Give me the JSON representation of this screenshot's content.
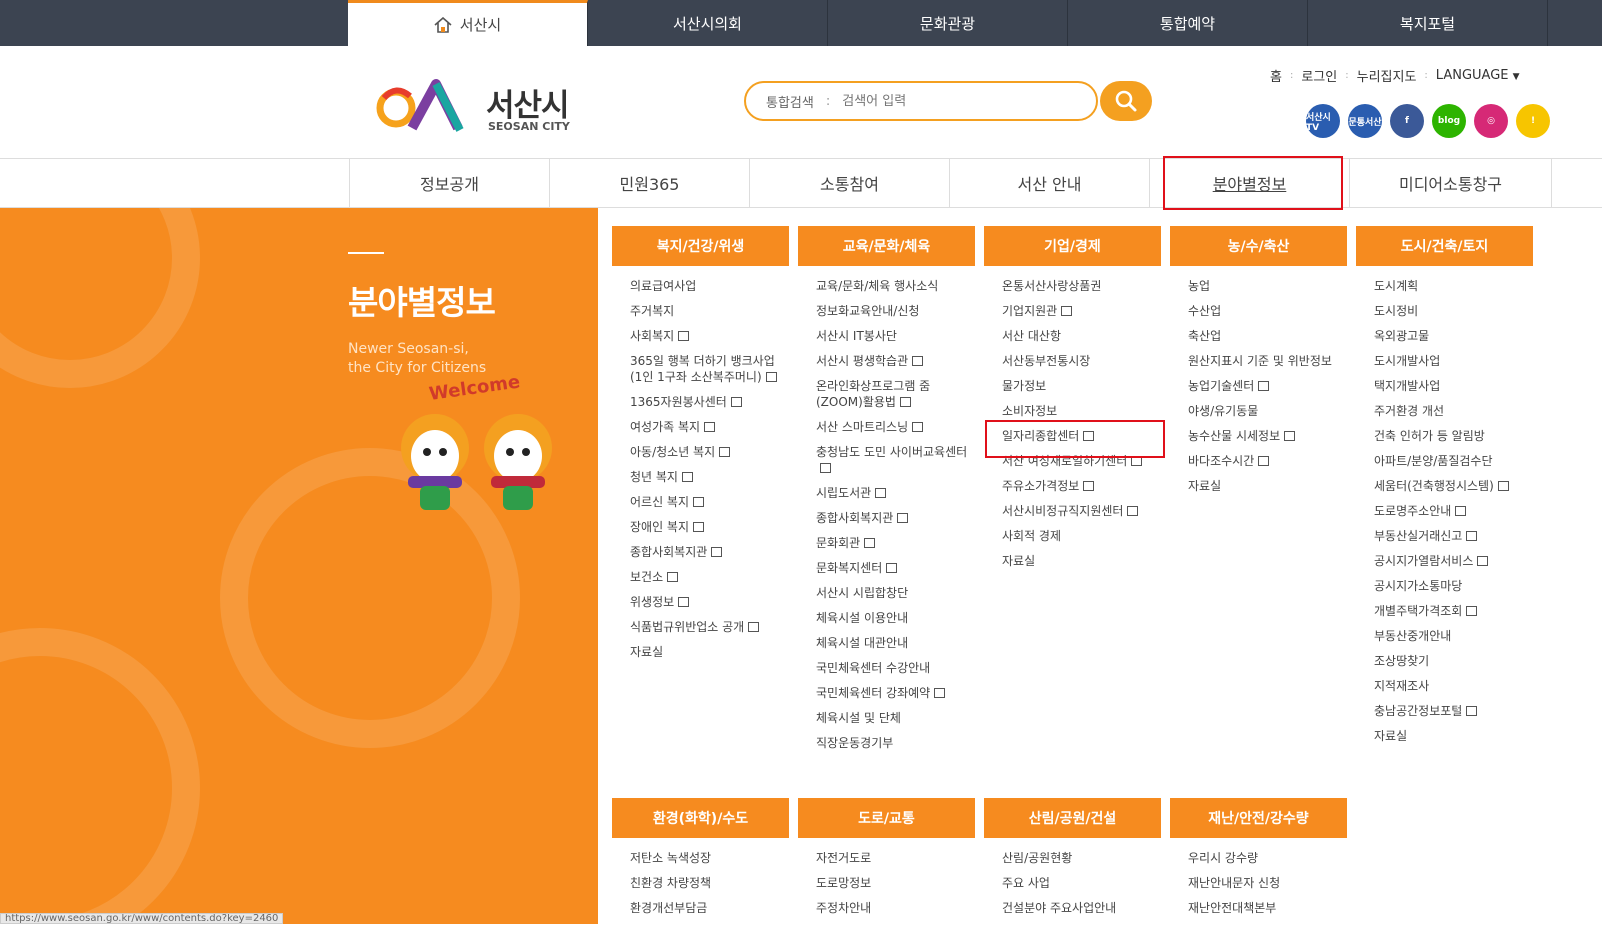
{
  "topbar": {
    "tabs": [
      "서산시",
      "서산시의회",
      "문화관광",
      "통합예약",
      "복지포털"
    ]
  },
  "logo": {
    "name": "서산시",
    "sub": "SEOSAN CITY"
  },
  "search": {
    "label": "통합검색",
    "placeholder": "검색어 입력"
  },
  "util": {
    "home": "홈",
    "login": "로그인",
    "map": "누리집지도",
    "language": "LANGUAGE"
  },
  "sns": [
    {
      "icon": "seosan-tv-icon",
      "label": "서산시TV",
      "color": "#2a5db0"
    },
    {
      "icon": "seosan-hub-icon",
      "label": "문통서산",
      "color": "#2a5db0"
    },
    {
      "icon": "facebook-icon",
      "label": "f",
      "color": "#3b5998"
    },
    {
      "icon": "blog-icon",
      "label": "blog",
      "color": "#2db400"
    },
    {
      "icon": "instagram-icon",
      "label": "◎",
      "color": "#d62976"
    },
    {
      "icon": "kakao-icon",
      "label": "!",
      "color": "#f7c500"
    }
  ],
  "gnb": [
    "정보공개",
    "민원365",
    "소통참여",
    "서산 안내",
    "분야별정보",
    "미디어소통창구"
  ],
  "side": {
    "title": "분야별정보",
    "slogan1": "Newer Seosan-si,",
    "slogan2": "the City for Citizens",
    "welcome": "Welcome"
  },
  "columns": [
    {
      "title": "복지/건강/위생",
      "items": [
        {
          "t": "의료급여사업"
        },
        {
          "t": "주거복지"
        },
        {
          "t": "사회복지",
          "n": true
        },
        {
          "t": "365일 행복 더하기 뱅크사업(1인 1구좌 소산복주머니)",
          "n": true
        },
        {
          "t": "1365자원봉사센터",
          "n": true
        },
        {
          "t": "여성가족 복지",
          "n": true
        },
        {
          "t": "아동/청소년 복지",
          "n": true
        },
        {
          "t": "청년 복지",
          "n": true
        },
        {
          "t": "어르신 복지",
          "n": true
        },
        {
          "t": "장애인 복지",
          "n": true
        },
        {
          "t": "종합사회복지관",
          "n": true
        },
        {
          "t": "보건소",
          "n": true
        },
        {
          "t": "위생정보",
          "n": true
        },
        {
          "t": "식품법규위반업소 공개",
          "n": true
        },
        {
          "t": "자료실"
        }
      ]
    },
    {
      "title": "교육/문화/체육",
      "items": [
        {
          "t": "교육/문화/체육 행사소식"
        },
        {
          "t": "정보화교육안내/신청"
        },
        {
          "t": "서산시 IT봉사단"
        },
        {
          "t": "서산시 평생학습관",
          "n": true
        },
        {
          "t": "온라인화상프로그램 줌(ZOOM)활용법",
          "n": true
        },
        {
          "t": "서산 스마트리스닝",
          "n": true
        },
        {
          "t": "충청남도 도민 사이버교육센터",
          "n": true
        },
        {
          "t": "시립도서관",
          "n": true
        },
        {
          "t": "종합사회복지관",
          "n": true
        },
        {
          "t": "문화회관",
          "n": true
        },
        {
          "t": "문화복지센터",
          "n": true
        },
        {
          "t": "서산시 시립합창단"
        },
        {
          "t": "체육시설 이용안내"
        },
        {
          "t": "체육시설 대관안내"
        },
        {
          "t": "국민체육센터 수강안내"
        },
        {
          "t": "국민체육센터 강좌예약",
          "n": true
        },
        {
          "t": "체육시설 및 단체"
        },
        {
          "t": "직장운동경기부"
        }
      ]
    },
    {
      "title": "기업/경제",
      "items": [
        {
          "t": "온통서산사랑상품권"
        },
        {
          "t": "기업지원관",
          "n": true
        },
        {
          "t": "서산 대산항"
        },
        {
          "t": "서산동부전통시장"
        },
        {
          "t": "물가정보"
        },
        {
          "t": "소비자정보"
        },
        {
          "t": "일자리종합센터",
          "n": true
        },
        {
          "t": "서산 여성새로일하기센터",
          "n": true
        },
        {
          "t": "주유소가격정보",
          "n": true
        },
        {
          "t": "서산시비정규직지원센터",
          "n": true
        },
        {
          "t": "사회적 경제"
        },
        {
          "t": "자료실"
        }
      ]
    },
    {
      "title": "농/수/축산",
      "items": [
        {
          "t": "농업"
        },
        {
          "t": "수산업"
        },
        {
          "t": "축산업"
        },
        {
          "t": "원산지표시 기준 및 위반정보"
        },
        {
          "t": "농업기술센터",
          "n": true
        },
        {
          "t": "야생/유기동물"
        },
        {
          "t": "농수산물 시세정보",
          "n": true
        },
        {
          "t": "바다조수시간",
          "n": true
        },
        {
          "t": "자료실"
        }
      ]
    },
    {
      "title": "도시/건축/토지",
      "items": [
        {
          "t": "도시계획"
        },
        {
          "t": "도시정비"
        },
        {
          "t": "옥외광고물"
        },
        {
          "t": "도시개발사업"
        },
        {
          "t": "택지개발사업"
        },
        {
          "t": "주거환경 개선"
        },
        {
          "t": "건축 인허가 등 알림방"
        },
        {
          "t": "아파트/분양/품질검수단"
        },
        {
          "t": "세움터(건축행정시스템)",
          "n": true
        },
        {
          "t": "도로명주소안내",
          "n": true
        },
        {
          "t": "부동산실거래신고",
          "n": true
        },
        {
          "t": "공시지가열람서비스",
          "n": true
        },
        {
          "t": "공시지가소통마당"
        },
        {
          "t": "개별주택가격조회",
          "n": true
        },
        {
          "t": "부동산중개안내"
        },
        {
          "t": "조상땅찾기"
        },
        {
          "t": "지적재조사"
        },
        {
          "t": "충남공간정보포털",
          "n": true
        },
        {
          "t": "자료실"
        }
      ]
    },
    {
      "title": "환경(화학)/수도",
      "items": [
        {
          "t": "저탄소 녹색성장"
        },
        {
          "t": "친환경 차량정책"
        },
        {
          "t": "환경개선부담금"
        }
      ]
    },
    {
      "title": "도로/교통",
      "items": [
        {
          "t": "자전거도로"
        },
        {
          "t": "도로망정보"
        },
        {
          "t": "주정차안내"
        }
      ]
    },
    {
      "title": "산림/공원/건설",
      "items": [
        {
          "t": "산림/공원현황"
        },
        {
          "t": "주요 사업"
        },
        {
          "t": "건설분야 주요사업안내"
        }
      ]
    },
    {
      "title": "재난/안전/강수량",
      "items": [
        {
          "t": "우리시 강수량"
        },
        {
          "t": "재난안내문자 신청"
        },
        {
          "t": "재난안전대책본부"
        }
      ]
    }
  ],
  "status_url": "https://www.seosan.go.kr/www/contents.do?key=2460"
}
